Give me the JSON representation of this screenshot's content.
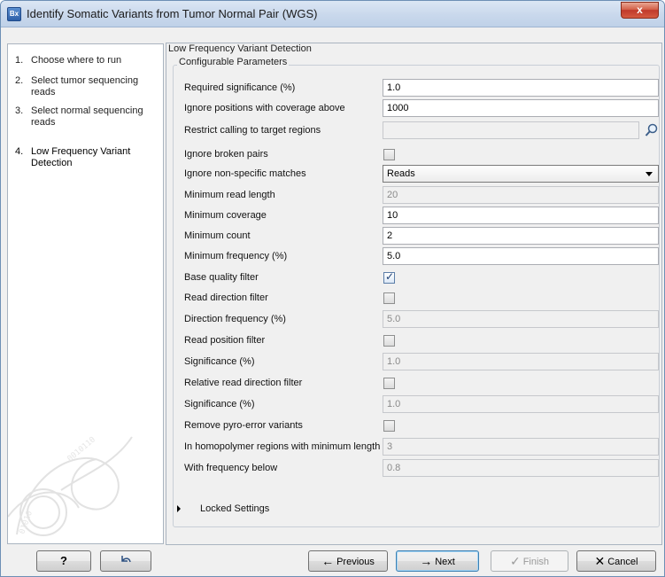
{
  "window": {
    "title": "Identify Somatic Variants from Tumor Normal Pair (WGS)",
    "app_icon_text": "Bx",
    "close_label": "x"
  },
  "steps": [
    {
      "num": "1.",
      "label": "Choose where to run"
    },
    {
      "num": "2.",
      "label": "Select tumor sequencing reads"
    },
    {
      "num": "3.",
      "label": "Select normal sequencing reads"
    },
    {
      "num": "4.",
      "label": "Low Frequency Variant Detection"
    }
  ],
  "panel": {
    "section_title": "Low Frequency Variant Detection",
    "group_title": "Configurable Parameters",
    "fields": {
      "required_significance": {
        "label": "Required significance (%)",
        "value": "1.0"
      },
      "ignore_coverage_above": {
        "label": "Ignore positions with coverage above",
        "value": "1000"
      },
      "restrict_target": {
        "label": "Restrict calling to target regions",
        "value": ""
      },
      "ignore_broken_pairs": {
        "label": "Ignore broken pairs",
        "checked": false
      },
      "ignore_nonspecific": {
        "label": "Ignore non-specific matches",
        "value": "Reads"
      },
      "min_read_length": {
        "label": "Minimum read length",
        "value": "20"
      },
      "min_coverage": {
        "label": "Minimum coverage",
        "value": "10"
      },
      "min_count": {
        "label": "Minimum count",
        "value": "2"
      },
      "min_frequency": {
        "label": "Minimum frequency (%)",
        "value": "5.0"
      },
      "base_quality_filter": {
        "label": "Base quality filter",
        "checked": true
      },
      "read_direction_filter": {
        "label": "Read direction filter",
        "checked": false
      },
      "direction_frequency": {
        "label": "Direction frequency (%)",
        "value": "5.0"
      },
      "read_position_filter": {
        "label": "Read position filter",
        "checked": false
      },
      "significance_1": {
        "label": "Significance (%)",
        "value": "1.0"
      },
      "relative_read_direction_filter": {
        "label": "Relative read direction filter",
        "checked": false
      },
      "significance_2": {
        "label": "Significance (%)",
        "value": "1.0"
      },
      "remove_pyro_error": {
        "label": "Remove pyro-error variants",
        "checked": false
      },
      "homopolymer_min_length": {
        "label": "In homopolymer regions with minimum length",
        "value": "3"
      },
      "with_frequency_below": {
        "label": "With frequency below",
        "value": "0.8"
      }
    },
    "locked_settings": "Locked Settings"
  },
  "buttons": {
    "help": "?",
    "previous": "Previous",
    "next": "Next",
    "finish": "Finish",
    "cancel": "Cancel"
  },
  "icons": {
    "app": "app-icon",
    "browse": "magnifier-icon",
    "reset": "reset-arrow-icon",
    "previous": "arrow-left-icon",
    "next": "arrow-right-icon",
    "finish": "checkmark-icon",
    "cancel": "x-icon"
  }
}
